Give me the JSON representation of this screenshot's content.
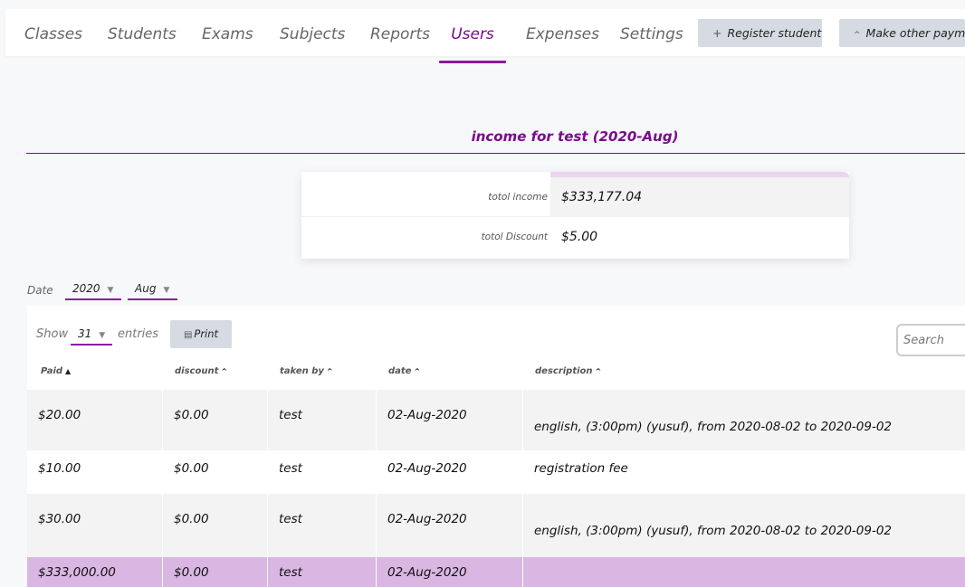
{
  "nav": {
    "tabs": [
      {
        "label": "Classes"
      },
      {
        "label": "Students"
      },
      {
        "label": "Exams"
      },
      {
        "label": "Subjects"
      },
      {
        "label": "Reports"
      },
      {
        "label": "Users",
        "active": true
      },
      {
        "label": "Expenses"
      },
      {
        "label": "Settings"
      }
    ],
    "register_button": "Register student",
    "register_icon": "plus-icon",
    "payment_button": "Make other payment",
    "payment_icon": "caret-up-icon"
  },
  "heading": "income for test (2020-Aug)",
  "summary": {
    "total_income_label": "totol income",
    "total_income_value": "$333,177.04",
    "total_discount_label": "totol Discount",
    "total_discount_value": "$5.00"
  },
  "filter": {
    "date_label": "Date",
    "year": "2020",
    "month": "Aug"
  },
  "table": {
    "show_label": "Show",
    "entries_value": "31",
    "entries_label": "entries",
    "print_label": "Print",
    "search_placeholder": "Search",
    "columns": [
      "Paid",
      "discount",
      "taken by",
      "date",
      "description"
    ],
    "rows": [
      {
        "paid": "$20.00",
        "discount": "$0.00",
        "taken_by": "test",
        "date": "02-Aug-2020",
        "description": "english, (3:00pm) (yusuf), from 2020-08-02 to 2020-09-02"
      },
      {
        "paid": "$10.00",
        "discount": "$0.00",
        "taken_by": "test",
        "date": "02-Aug-2020",
        "description": "registration fee"
      },
      {
        "paid": "$30.00",
        "discount": "$0.00",
        "taken_by": "test",
        "date": "02-Aug-2020",
        "description": "english, (3:00pm) (yusuf), from 2020-08-02 to 2020-09-02"
      },
      {
        "paid": "$333,000.00",
        "discount": "$0.00",
        "taken_by": "test",
        "date": "02-Aug-2020",
        "description": ""
      }
    ]
  },
  "colors": {
    "accent": "#7a0a8c",
    "highlight_row": "#dab6e3",
    "button_bg": "#d6dbe3"
  }
}
